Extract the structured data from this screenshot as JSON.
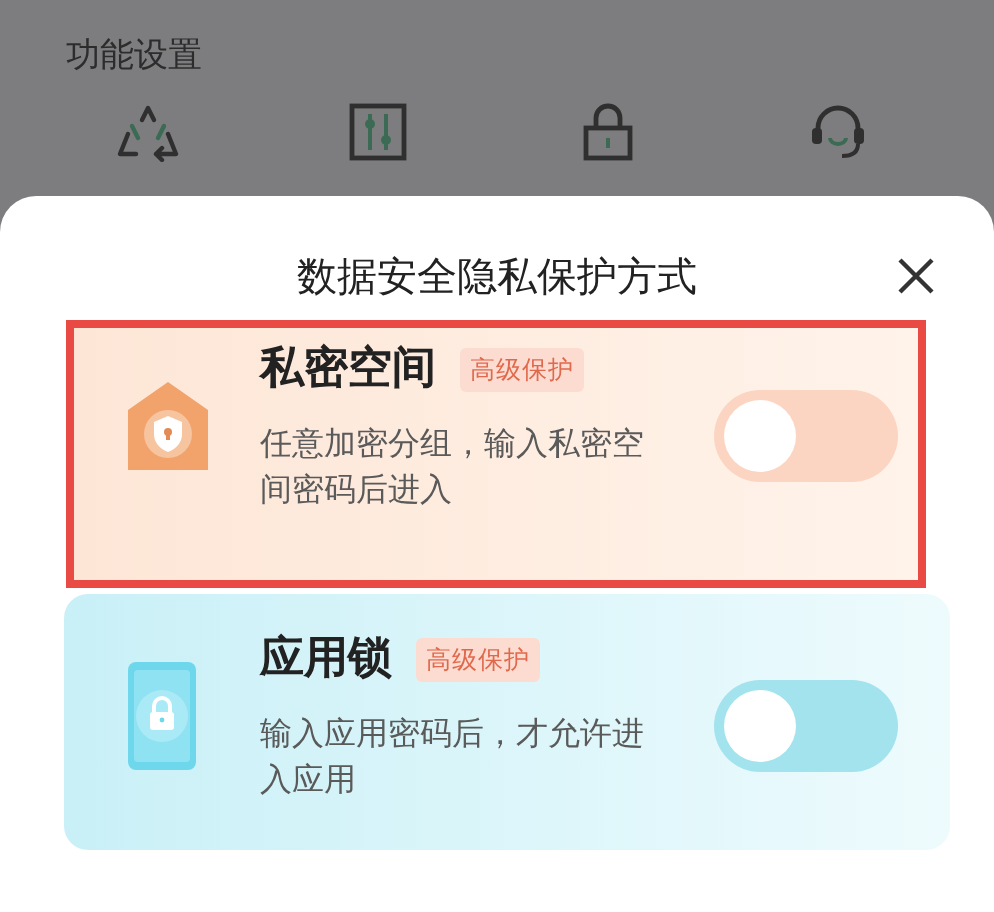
{
  "background": {
    "section_title": "功能设置",
    "icons": [
      {
        "kind": "recycle"
      },
      {
        "kind": "sliders"
      },
      {
        "kind": "lock"
      },
      {
        "kind": "headset"
      }
    ]
  },
  "sheet": {
    "title": "数据安全隐私保护方式",
    "options": [
      {
        "kind": "private-space",
        "title": "私密空间",
        "badge": "高级保护",
        "description": "任意加密分组，输入私密空间密码后进入",
        "on": false,
        "highlighted": true
      },
      {
        "kind": "app-lock",
        "title": "应用锁",
        "badge": "高级保护",
        "description": "输入应用密码后，才允许进入应用",
        "on": false,
        "highlighted": false
      }
    ]
  }
}
